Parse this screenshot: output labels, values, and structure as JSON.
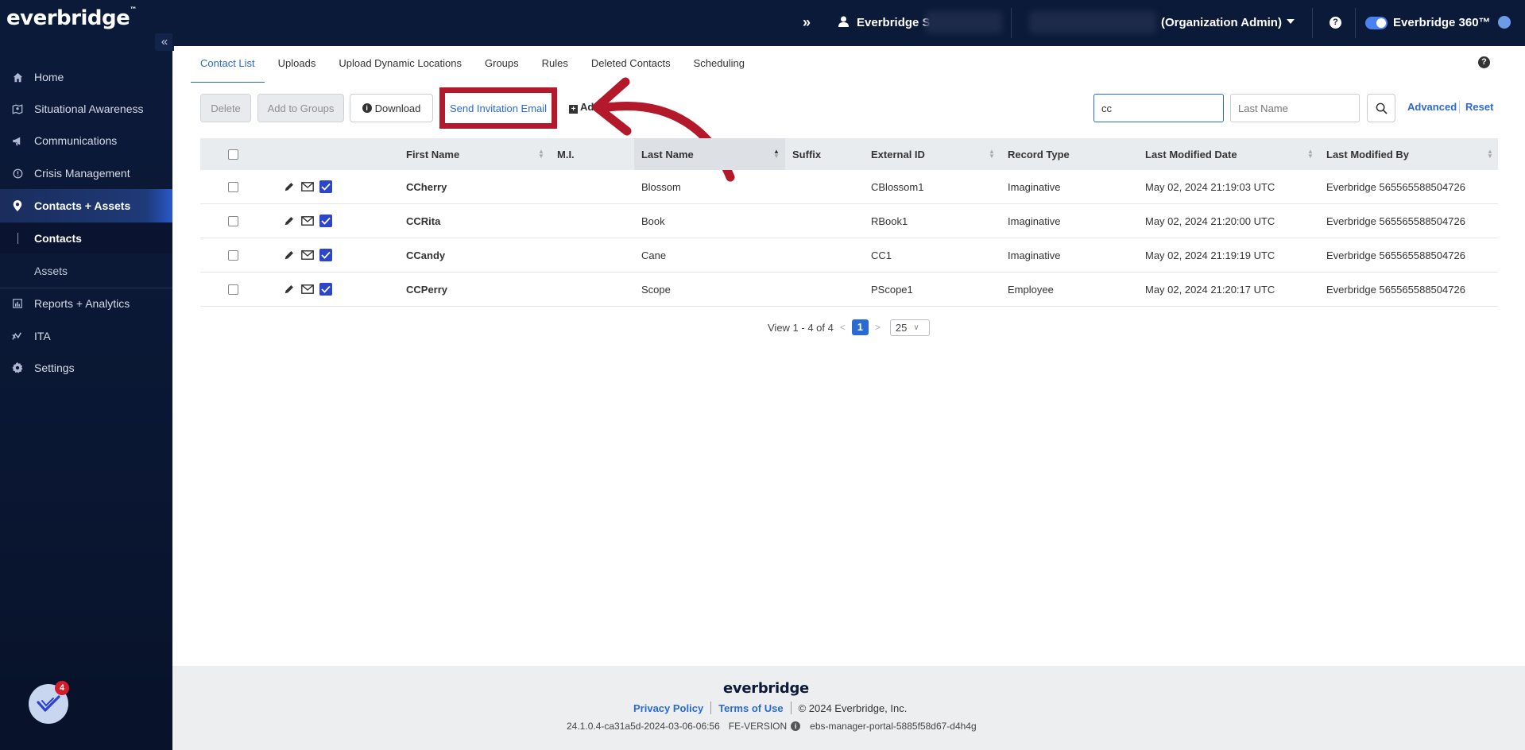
{
  "sidebar": {
    "logo": "everbridge",
    "collapse_icon": "«",
    "items": [
      {
        "label": "Home",
        "icon": "home-icon"
      },
      {
        "label": "Situational Awareness",
        "icon": "map-icon"
      },
      {
        "label": "Communications",
        "icon": "megaphone-icon"
      },
      {
        "label": "Crisis Management",
        "icon": "alert-icon"
      },
      {
        "label": "Contacts + Assets",
        "icon": "location-pin-icon"
      },
      {
        "label": "Reports + Analytics",
        "icon": "chart-icon"
      },
      {
        "label": "ITA",
        "icon": "ita-icon"
      },
      {
        "label": "Settings",
        "icon": "gear-icon"
      }
    ],
    "sub_items": [
      {
        "label": "Contacts"
      },
      {
        "label": "Assets"
      }
    ],
    "chat_badge": "4"
  },
  "topbar": {
    "expand": "»",
    "user_name": "Everbridge S",
    "org_role": "(Organization Admin)",
    "help": "?",
    "product": "Everbridge 360™"
  },
  "tabs": [
    "Contact List",
    "Uploads",
    "Upload Dynamic Locations",
    "Groups",
    "Rules",
    "Deleted Contacts",
    "Scheduling"
  ],
  "toolbar": {
    "delete": "Delete",
    "add_to_groups": "Add to Groups",
    "download": "Download",
    "send_invitation": "Send Invitation Email",
    "add": "Add"
  },
  "search": {
    "first_value": "cc",
    "last_placeholder": "Last Name",
    "advanced": "Advanced",
    "reset": "Reset"
  },
  "table": {
    "headers": {
      "first_name": "First Name",
      "mi": "M.I.",
      "last_name": "Last Name",
      "suffix": "Suffix",
      "external_id": "External ID",
      "record_type": "Record Type",
      "last_modified_date": "Last Modified Date",
      "last_modified_by": "Last Modified By"
    },
    "rows": [
      {
        "first_name": "CCherry",
        "mi": "",
        "last_name": "Blossom",
        "suffix": "",
        "external_id": "CBlossom1",
        "record_type": "Imaginative",
        "last_modified_date": "May 02, 2024 21:19:03 UTC",
        "last_modified_by": "Everbridge 565565588504726"
      },
      {
        "first_name": "CCRita",
        "mi": "",
        "last_name": "Book",
        "suffix": "",
        "external_id": "RBook1",
        "record_type": "Imaginative",
        "last_modified_date": "May 02, 2024 21:20:00 UTC",
        "last_modified_by": "Everbridge 565565588504726"
      },
      {
        "first_name": "CCandy",
        "mi": "",
        "last_name": "Cane",
        "suffix": "",
        "external_id": "CC1",
        "record_type": "Imaginative",
        "last_modified_date": "May 02, 2024 21:19:19 UTC",
        "last_modified_by": "Everbridge 565565588504726"
      },
      {
        "first_name": "CCPerry",
        "mi": "",
        "last_name": "Scope",
        "suffix": "",
        "external_id": "PScope1",
        "record_type": "Employee",
        "last_modified_date": "May 02, 2024 21:20:17 UTC",
        "last_modified_by": "Everbridge 565565588504726"
      }
    ]
  },
  "pagination": {
    "summary": "View 1 - 4 of 4",
    "current": "1",
    "page_size": "25"
  },
  "footer": {
    "logo": "everbridge",
    "privacy": "Privacy Policy",
    "terms": "Terms of Use",
    "copyright": "© 2024 Everbridge, Inc.",
    "version": "24.1.0.4-ca31a5d-2024-03-06-06:56",
    "fe_version": "FE-VERSION",
    "server": "ebs-manager-portal-5885f58d67-d4h4g"
  },
  "colors": {
    "sidebar_bg": "#0c1a3a",
    "accent": "#2a6ad1",
    "highlight": "#b3192b"
  }
}
